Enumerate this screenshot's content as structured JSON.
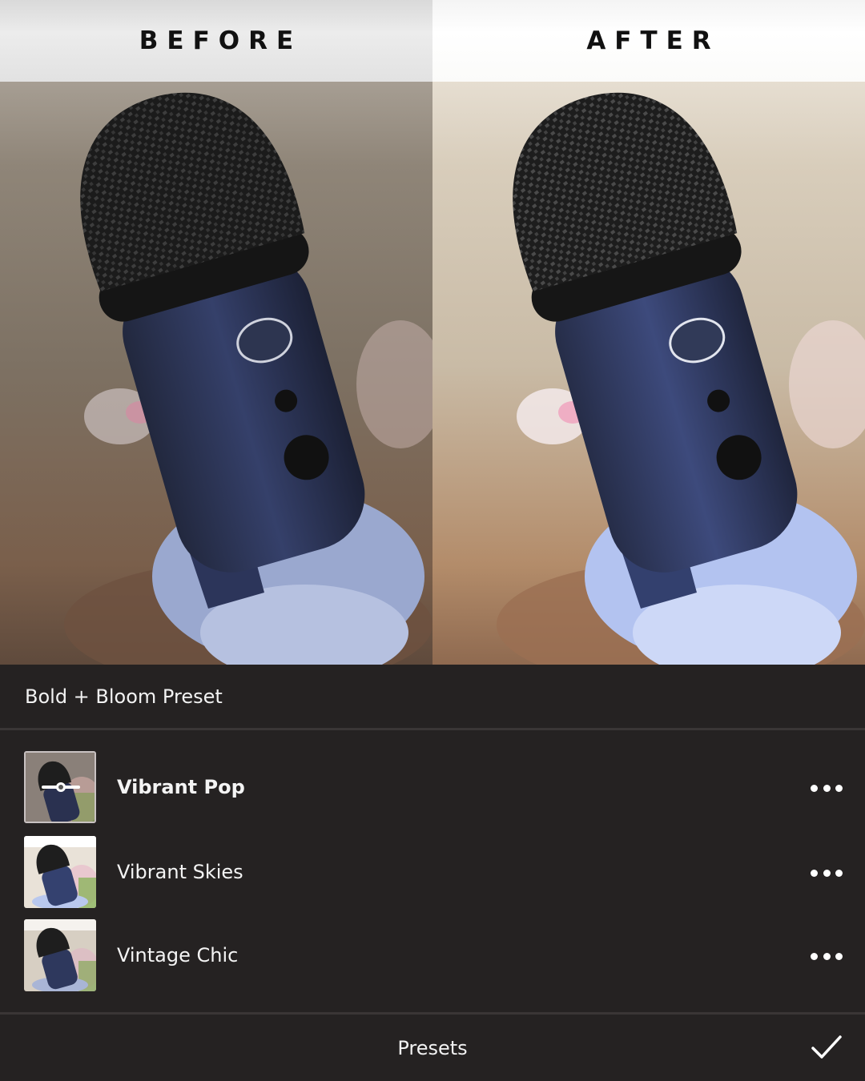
{
  "compare": {
    "before_label": "BEFORE",
    "after_label": "AFTER"
  },
  "panel": {
    "title": "Bold + Bloom Preset",
    "presets": [
      {
        "name": "Vibrant Pop",
        "selected": true,
        "thumbnail_icon": "adjust-slider-icon",
        "menu_icon": "more-icon"
      },
      {
        "name": "Vibrant Skies",
        "selected": false,
        "menu_icon": "more-icon"
      },
      {
        "name": "Vintage Chic",
        "selected": false,
        "menu_icon": "more-icon"
      }
    ],
    "footer": {
      "title": "Presets",
      "confirm_icon": "checkmark-icon"
    }
  },
  "colors": {
    "panel_bg": "#252222",
    "divider": "#3a3636",
    "text": "#f2f2f2",
    "mic_body": "#2f3a5e",
    "mic_grille": "#1a1a1a"
  }
}
